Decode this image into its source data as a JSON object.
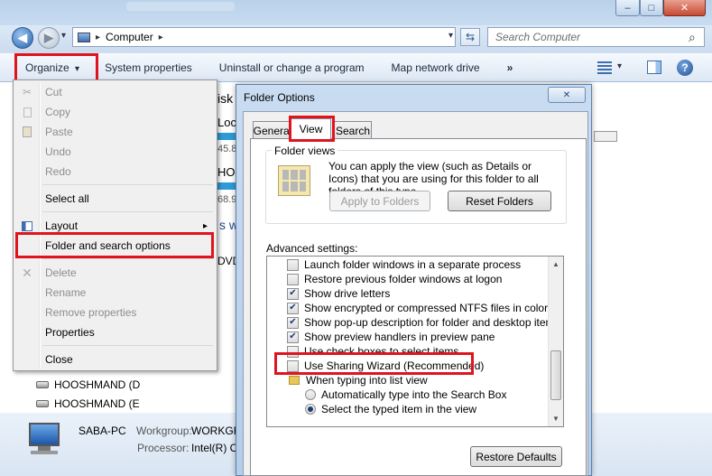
{
  "window": {
    "min_label": "–",
    "max_label": "□",
    "close_label": "✕",
    "icon_color": "#2764b0"
  },
  "nav": {
    "back_glyph": "◀",
    "forward_glyph": "▶",
    "address": "Computer",
    "address_arrow": "▸",
    "dropdown_glyph": "▾",
    "refresh_glyph": "⇆",
    "search_placeholder": "Search Computer",
    "search_glyph": "⌕"
  },
  "cmdbar": {
    "organize": "Organize",
    "organize_arrow": "▾",
    "system_properties": "System properties",
    "uninstall": "Uninstall or change a program",
    "map_drive": "Map network drive",
    "more": "»",
    "help": "?"
  },
  "menu": {
    "items": [
      {
        "label": "Cut",
        "disabled": true,
        "icon": "cut-icon"
      },
      {
        "label": "Copy",
        "disabled": true,
        "icon": "copy-icon"
      },
      {
        "label": "Paste",
        "disabled": true,
        "icon": "paste-icon"
      },
      {
        "label": "Undo",
        "disabled": true
      },
      {
        "label": "Redo",
        "disabled": true
      },
      {
        "label": "Select all",
        "disabled": false
      },
      {
        "label": "Layout",
        "disabled": false,
        "icon": "layout-icon",
        "submenu": "▸"
      },
      {
        "label": "Folder and search options",
        "disabled": false
      },
      {
        "label": "Delete",
        "disabled": true,
        "icon": "delete-icon"
      },
      {
        "label": "Rename",
        "disabled": true
      },
      {
        "label": "Remove properties",
        "disabled": true
      },
      {
        "label": "Properties",
        "disabled": false
      },
      {
        "label": "Close",
        "disabled": false
      }
    ]
  },
  "background": {
    "isk": "isk",
    "loc": "Loc",
    "n1": "45.8",
    "hoc1": "HOO",
    "n2": "68.9",
    "s_wi": "s wi",
    "dvd": "DVD",
    "drive1": "HOOSHMAND (D",
    "drive2": "HOOSHMAND (E",
    "pc_name": "SABA-PC",
    "workgroup_label": "Workgroup:",
    "workgroup_value": "WORKGR",
    "processor_label": "Processor:",
    "processor_value": "Intel(R) C"
  },
  "dialog": {
    "title": "Folder Options",
    "close_label": "✕",
    "tabs": [
      "General",
      "View",
      "Search"
    ],
    "folder_views": {
      "heading": "Folder views",
      "description": "You can apply the view (such as Details or Icons) that you are using for this folder to all folders of this type.",
      "apply_button": "Apply to Folders",
      "reset_button": "Reset Folders"
    },
    "advanced_label": "Advanced settings:",
    "settings": [
      {
        "label": "Launch folder windows in a separate process",
        "kind": "checkbox",
        "checked": false
      },
      {
        "label": "Restore previous folder windows at logon",
        "kind": "checkbox",
        "checked": false
      },
      {
        "label": "Show drive letters",
        "kind": "checkbox",
        "checked": true
      },
      {
        "label": "Show encrypted or compressed NTFS files in color",
        "kind": "checkbox",
        "checked": true
      },
      {
        "label": "Show pop-up description for folder and desktop items",
        "kind": "checkbox",
        "checked": true
      },
      {
        "label": "Show preview handlers in preview pane",
        "kind": "checkbox",
        "checked": true
      },
      {
        "label": "Use check boxes to select items",
        "kind": "checkbox",
        "checked": false
      },
      {
        "label": "Use Sharing Wizard (Recommended)",
        "kind": "checkbox",
        "checked": false
      },
      {
        "label": "When typing into list view",
        "kind": "folder"
      },
      {
        "label": "Automatically type into the Search Box",
        "kind": "radio",
        "checked": false
      },
      {
        "label": "Select the typed item in the view",
        "kind": "radio",
        "checked": true
      }
    ],
    "check_glyph": "✔",
    "restore_defaults": "Restore Defaults"
  },
  "colors": {
    "highlight": "#e0141f",
    "accent": "#2764b0"
  }
}
